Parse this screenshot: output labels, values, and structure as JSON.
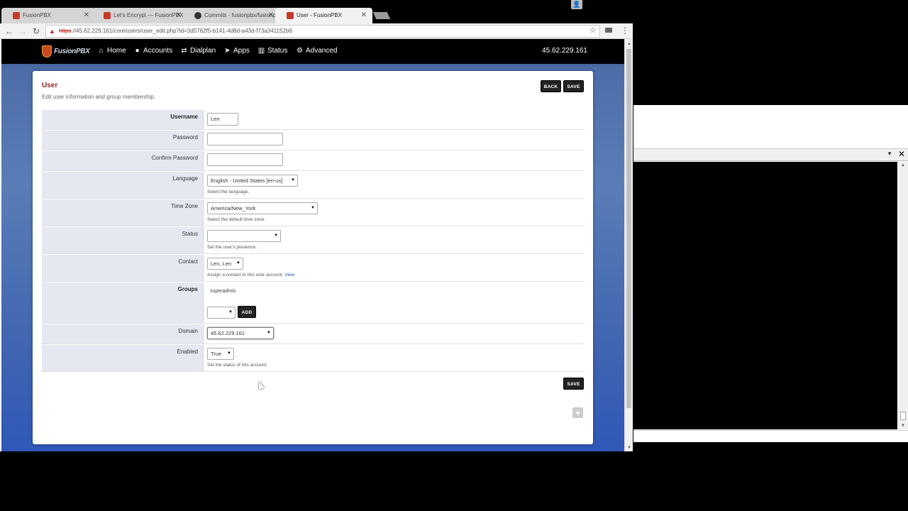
{
  "browser": {
    "tabs": [
      {
        "label": "FusionPBX",
        "icon": "fusionpbx-icon"
      },
      {
        "label": "Let's Encrypt — FusionPBX",
        "icon": "fusionpbx-icon"
      },
      {
        "label": "Commits · fusionpbx/fusionpbx",
        "icon": "github-icon"
      },
      {
        "label": "User - FusionPBX",
        "icon": "fusionpbx-icon",
        "active": true
      }
    ],
    "url_scheme": "https",
    "url_rest": "://45.62.229.161/core/users/user_edit.php?id=3d5762f5-b141-4d8d-a43d-f73a341152b6"
  },
  "nav": {
    "logo_text": "FusionPBX",
    "items": [
      {
        "label": "Home",
        "icon": "home-icon"
      },
      {
        "label": "Accounts",
        "icon": "user-icon"
      },
      {
        "label": "Dialplan",
        "icon": "exchange-icon"
      },
      {
        "label": "Apps",
        "icon": "send-icon"
      },
      {
        "label": "Status",
        "icon": "bar-chart-icon"
      },
      {
        "label": "Advanced",
        "icon": "gear-icon"
      }
    ],
    "domain": "45.62.229.161"
  },
  "page": {
    "title": "User",
    "description": "Edit user information and group membership.",
    "back_label": "BACK",
    "save_label": "SAVE",
    "add_label": "ADD"
  },
  "form": {
    "username": {
      "label": "Username",
      "value": "Len"
    },
    "password": {
      "label": "Password",
      "value": ""
    },
    "confirm_password": {
      "label": "Confirm Password",
      "value": ""
    },
    "language": {
      "label": "Language",
      "value": "English - United States [en-us]",
      "hint": "Select the language."
    },
    "time_zone": {
      "label": "Time Zone",
      "value": "America/New_York",
      "hint": "Select the default time zone."
    },
    "status": {
      "label": "Status",
      "value": "",
      "hint": "Set the user's presence."
    },
    "contact": {
      "label": "Contact",
      "value": "Len, Len",
      "hint": "Assign a contact to this user account.",
      "hint_link": "View"
    },
    "groups": {
      "label": "Groups",
      "items": [
        "superadmin"
      ],
      "select_value": ""
    },
    "domain": {
      "label": "Domain",
      "value": "45.62.229.161"
    },
    "enabled": {
      "label": "Enabled",
      "value": "True",
      "hint": "Set the status of this account."
    }
  }
}
